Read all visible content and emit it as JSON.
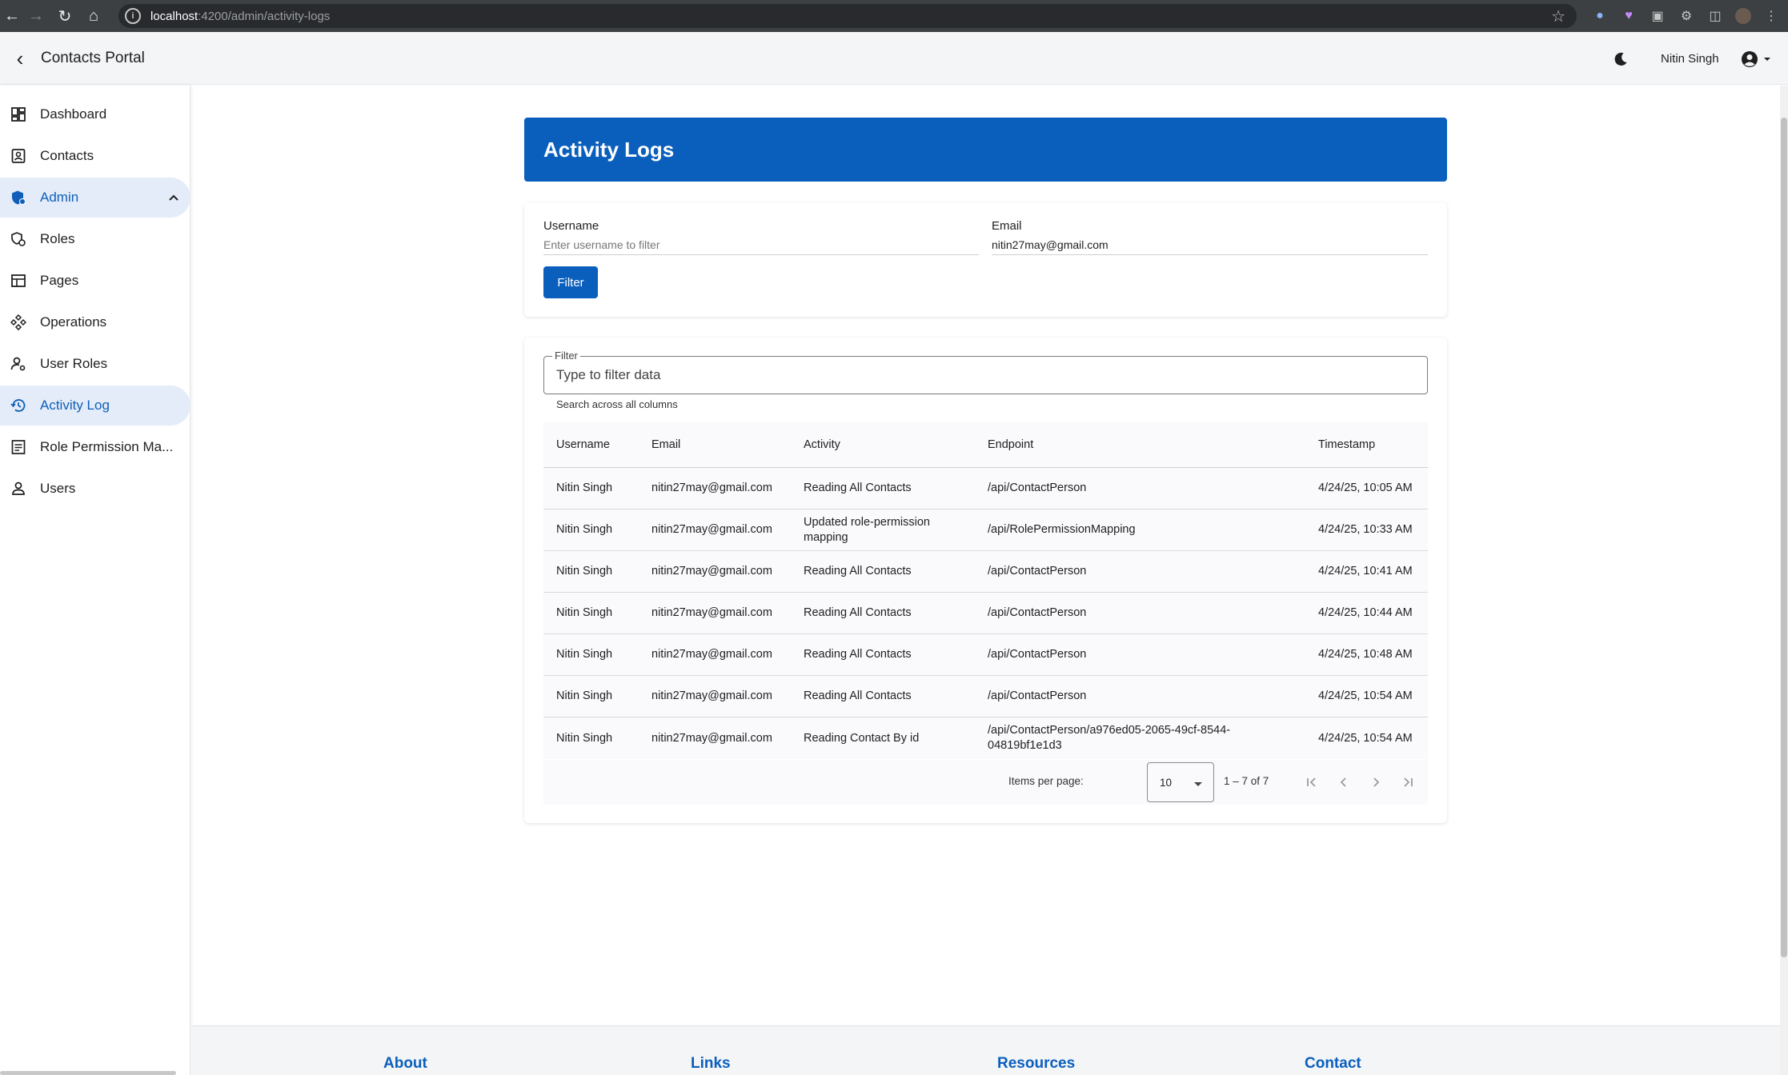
{
  "browser": {
    "url_host": "localhost",
    "url_path": ":4200/admin/activity-logs"
  },
  "header": {
    "app_title": "Contacts Portal",
    "user_name": "Nitin Singh"
  },
  "sidebar": {
    "items": [
      {
        "label": "Dashboard"
      },
      {
        "label": "Contacts"
      },
      {
        "label": "Admin"
      },
      {
        "label": "Roles"
      },
      {
        "label": "Pages"
      },
      {
        "label": "Operations"
      },
      {
        "label": "User Roles"
      },
      {
        "label": "Activity Log"
      },
      {
        "label": "Role Permission Ma..."
      },
      {
        "label": "Users"
      }
    ]
  },
  "main": {
    "title": "Activity Logs",
    "filter_form": {
      "username_label": "Username",
      "username_placeholder": "Enter username to filter",
      "username_value": "",
      "email_label": "Email",
      "email_value": "nitin27may@gmail.com",
      "filter_button": "Filter"
    },
    "table_filter": {
      "legend": "Filter",
      "placeholder": "Type to filter data",
      "hint": "Search across all columns"
    },
    "columns": [
      "Username",
      "Email",
      "Activity",
      "Endpoint",
      "Timestamp"
    ],
    "rows": [
      {
        "username": "Nitin Singh",
        "email": "nitin27may@gmail.com",
        "activity": "Reading All Contacts",
        "endpoint": "/api/ContactPerson",
        "timestamp": "4/24/25, 10:05 AM"
      },
      {
        "username": "Nitin Singh",
        "email": "nitin27may@gmail.com",
        "activity": "Updated role-permission mapping",
        "endpoint": "/api/RolePermissionMapping",
        "timestamp": "4/24/25, 10:33 AM"
      },
      {
        "username": "Nitin Singh",
        "email": "nitin27may@gmail.com",
        "activity": "Reading All Contacts",
        "endpoint": "/api/ContactPerson",
        "timestamp": "4/24/25, 10:41 AM"
      },
      {
        "username": "Nitin Singh",
        "email": "nitin27may@gmail.com",
        "activity": "Reading All Contacts",
        "endpoint": "/api/ContactPerson",
        "timestamp": "4/24/25, 10:44 AM"
      },
      {
        "username": "Nitin Singh",
        "email": "nitin27may@gmail.com",
        "activity": "Reading All Contacts",
        "endpoint": "/api/ContactPerson",
        "timestamp": "4/24/25, 10:48 AM"
      },
      {
        "username": "Nitin Singh",
        "email": "nitin27may@gmail.com",
        "activity": "Reading All Contacts",
        "endpoint": "/api/ContactPerson",
        "timestamp": "4/24/25, 10:54 AM"
      },
      {
        "username": "Nitin Singh",
        "email": "nitin27may@gmail.com",
        "activity": "Reading Contact By id",
        "endpoint": "/api/ContactPerson/a976ed05-2065-49cf-8544-04819bf1e1d3",
        "timestamp": "4/24/25, 10:54 AM"
      }
    ],
    "paginator": {
      "items_per_page_label": "Items per page:",
      "page_size": "10",
      "range_label": "1 – 7 of 7"
    }
  },
  "footer": {
    "headings": [
      "About",
      "Links",
      "Resources",
      "Contact"
    ]
  },
  "colors": {
    "primary": "#0a5fbd",
    "active_nav_bg": "#e3ecf8"
  }
}
